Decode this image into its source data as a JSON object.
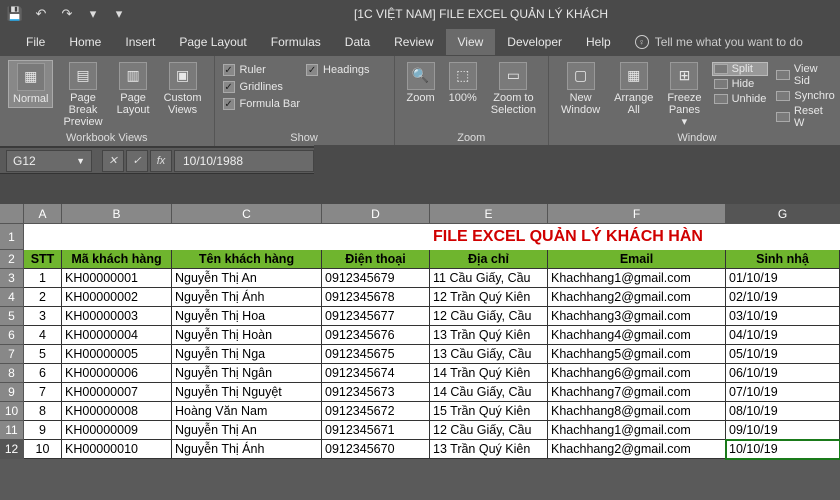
{
  "title": "[1C VIỆT NAM] FILE EXCEL QUẢN LÝ KHÁCH",
  "tabs": [
    "File",
    "Home",
    "Insert",
    "Page Layout",
    "Formulas",
    "Data",
    "Review",
    "View",
    "Developer",
    "Help"
  ],
  "active_tab": "View",
  "tell_me": "Tell me what you want to do",
  "ribbon": {
    "workbook_views": {
      "label": "Workbook Views",
      "buttons": [
        "Normal",
        "Page Break Preview",
        "Page Layout",
        "Custom Views"
      ]
    },
    "show": {
      "label": "Show",
      "checks": {
        "ruler": "Ruler",
        "gridlines": "Gridlines",
        "formula_bar": "Formula Bar",
        "headings": "Headings"
      }
    },
    "zoom": {
      "label": "Zoom",
      "buttons": [
        "Zoom",
        "100%",
        "Zoom to Selection"
      ]
    },
    "window": {
      "label": "Window",
      "buttons": [
        "New Window",
        "Arrange All",
        "Freeze Panes"
      ],
      "items": {
        "split": "Split",
        "hide": "Hide",
        "unhide": "Unhide",
        "view_side": "View Sid",
        "synchro": "Synchro",
        "reset": "Reset W"
      }
    }
  },
  "namebox": "G12",
  "formula": "10/10/1988",
  "sheet": {
    "columns": [
      "A",
      "B",
      "C",
      "D",
      "E",
      "F",
      "G"
    ],
    "title": "FILE EXCEL QUẢN LÝ KHÁCH HÀN",
    "headers": {
      "stt": "STT",
      "ma": "Mã khách hàng",
      "ten": "Tên khách hàng",
      "dt": "Điện thoại",
      "dc": "Địa chỉ",
      "email": "Email",
      "sn": "Sinh nhậ"
    },
    "rows": [
      {
        "r": 3,
        "stt": "1",
        "ma": "KH00000001",
        "ten": "Nguyễn Thị An",
        "dt": "0912345679",
        "dc": "11 Cầu Giấy, Cầu",
        "email": "Khachhang1@gmail.com",
        "sn": "01/10/19"
      },
      {
        "r": 4,
        "stt": "2",
        "ma": "KH00000002",
        "ten": "Nguyễn Thị Ánh",
        "dt": "0912345678",
        "dc": "12 Trần Quý Kiên",
        "email": "Khachhang2@gmail.com",
        "sn": "02/10/19"
      },
      {
        "r": 5,
        "stt": "3",
        "ma": "KH00000003",
        "ten": "Nguyễn Thị Hoa",
        "dt": "0912345677",
        "dc": "12 Cầu Giấy, Cầu",
        "email": "Khachhang3@gmail.com",
        "sn": "03/10/19"
      },
      {
        "r": 6,
        "stt": "4",
        "ma": "KH00000004",
        "ten": "Nguyễn Thị Hoàn",
        "dt": "0912345676",
        "dc": "13 Trần Quý Kiên",
        "email": "Khachhang4@gmail.com",
        "sn": "04/10/19"
      },
      {
        "r": 7,
        "stt": "5",
        "ma": "KH00000005",
        "ten": "Nguyễn Thị Nga",
        "dt": "0912345675",
        "dc": "13 Cầu Giấy, Cầu",
        "email": "Khachhang5@gmail.com",
        "sn": "05/10/19"
      },
      {
        "r": 8,
        "stt": "6",
        "ma": "KH00000006",
        "ten": "Nguyễn Thị Ngân",
        "dt": "0912345674",
        "dc": "14 Trần Quý Kiên",
        "email": "Khachhang6@gmail.com",
        "sn": "06/10/19"
      },
      {
        "r": 9,
        "stt": "7",
        "ma": "KH00000007",
        "ten": "Nguyễn Thị Nguyệt",
        "dt": "0912345673",
        "dc": "14 Cầu Giấy, Cầu",
        "email": "Khachhang7@gmail.com",
        "sn": "07/10/19"
      },
      {
        "r": 10,
        "stt": "8",
        "ma": "KH00000008",
        "ten": "Hoàng Văn Nam",
        "dt": "0912345672",
        "dc": "15 Trần Quý Kiên",
        "email": "Khachhang8@gmail.com",
        "sn": "08/10/19"
      },
      {
        "r": 11,
        "stt": "9",
        "ma": "KH00000009",
        "ten": "Nguyễn Thị An",
        "dt": "0912345671",
        "dc": "12 Cầu Giấy, Cầu",
        "email": "Khachhang1@gmail.com",
        "sn": "09/10/19"
      },
      {
        "r": 12,
        "stt": "10",
        "ma": "KH00000010",
        "ten": "Nguyễn Thị Ánh",
        "dt": "0912345670",
        "dc": "13 Trần Quý Kiên",
        "email": "Khachhang2@gmail.com",
        "sn": "10/10/19"
      }
    ]
  }
}
